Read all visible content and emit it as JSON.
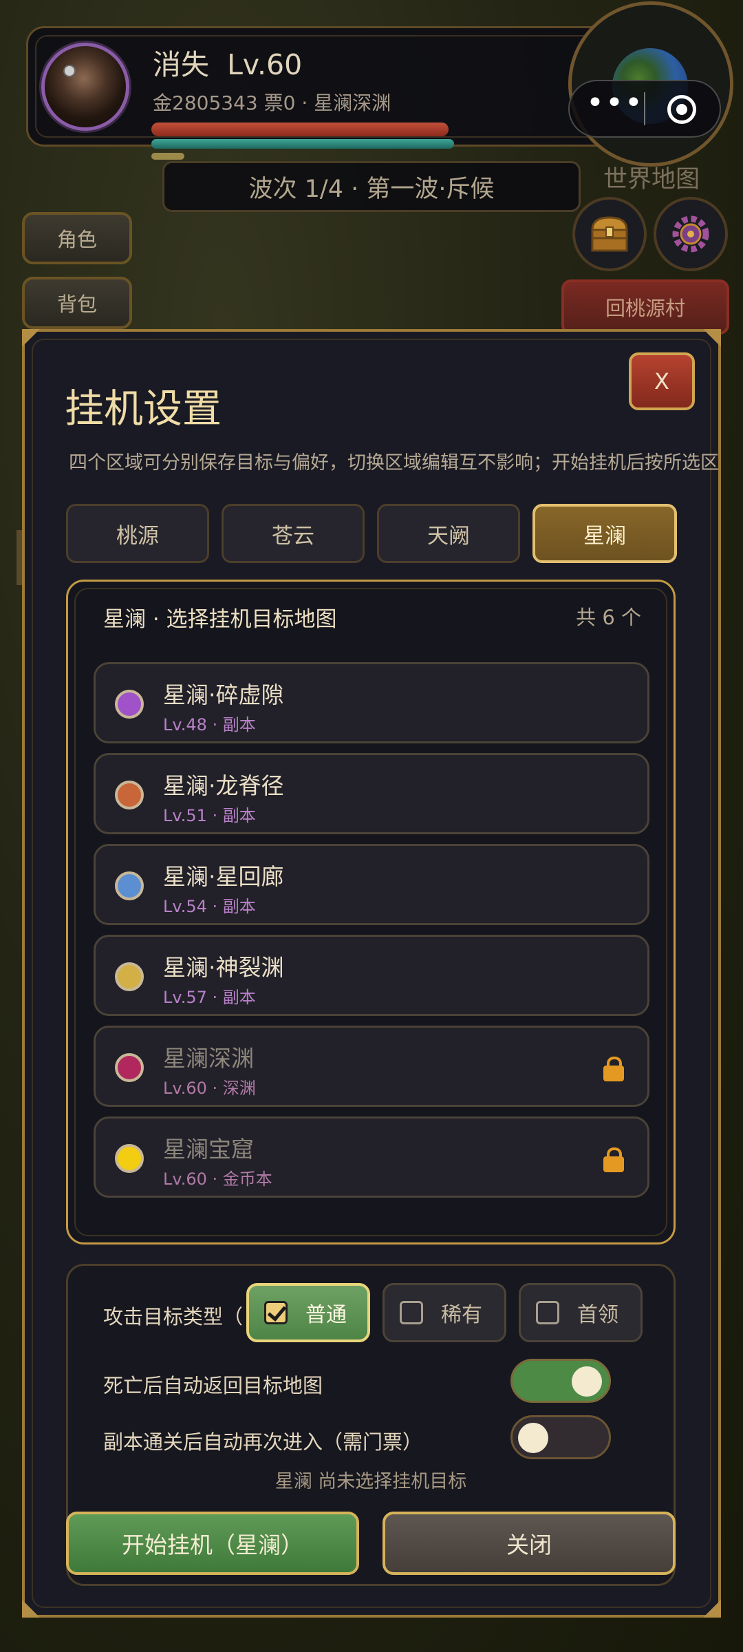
{
  "player": {
    "name": "消失",
    "level": "Lv.60",
    "stats": "金2805343 票0 · 星澜深渊"
  },
  "mini_program": {
    "menu_icon": "more-dots-icon",
    "close_icon": "target-circle-icon"
  },
  "world_map_label": "世界地图",
  "wave_text": "波次 1/4 · 第一波·斥候",
  "side_buttons": {
    "role": "角色",
    "bag": "背包"
  },
  "return_village": "回桃源村",
  "modal": {
    "title": "挂机设置",
    "close_label": "X",
    "description": "四个区域可分别保存目标与偏好，切换区域编辑互不影响；开始挂机后按所选区",
    "tabs": [
      "桃源",
      "苍云",
      "天阙",
      "星澜"
    ],
    "active_tab": "星澜",
    "list_title": "星澜 · 选择挂机目标地图",
    "list_count": "共 6 个",
    "maps": [
      {
        "name": "星澜·碎虚隙",
        "sub": "Lv.48 · 副本",
        "color": "#a052c8",
        "locked": false
      },
      {
        "name": "星澜·龙脊径",
        "sub": "Lv.51 · 副本",
        "color": "#c8663a",
        "locked": false
      },
      {
        "name": "星澜·星回廊",
        "sub": "Lv.54 · 副本",
        "color": "#5b8fd2",
        "locked": false
      },
      {
        "name": "星澜·神裂渊",
        "sub": "Lv.57 · 副本",
        "color": "#d2b045",
        "locked": false
      },
      {
        "name": "星澜深渊",
        "sub": "Lv.60 · 深渊",
        "color": "#b0285e",
        "locked": true
      },
      {
        "name": "星澜宝窟",
        "sub": "Lv.60 · 金币本",
        "color": "#f3cd12",
        "locked": true
      }
    ],
    "attack_label": "攻击目标类型（",
    "attack_options": [
      {
        "label": "普通",
        "checked": true
      },
      {
        "label": "稀有",
        "checked": false
      },
      {
        "label": "首领",
        "checked": false
      }
    ],
    "auto_return_label": "死亡后自动返回目标地图",
    "auto_return_on": true,
    "auto_reenter_label": "副本通关后自动再次进入（需门票）",
    "auto_reenter_on": false,
    "hint": "星澜 尚未选择挂机目标",
    "start_button": "开始挂机（星澜）",
    "close_button": "关闭"
  }
}
